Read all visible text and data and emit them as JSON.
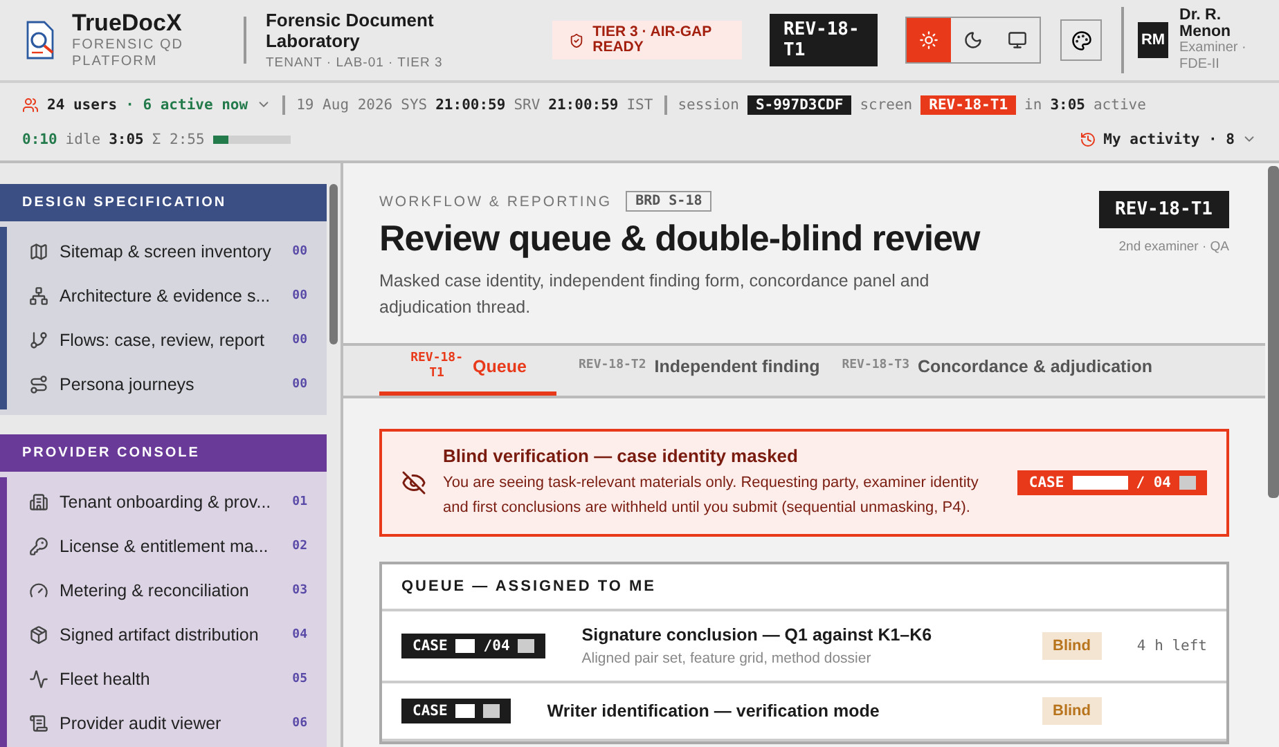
{
  "brand": {
    "name": "TrueDocX",
    "tagline": "FORENSIC QD PLATFORM"
  },
  "lab": {
    "name": "Forensic Document Laboratory",
    "tenant": "TENANT · LAB-01 · TIER 3"
  },
  "tier_badge": "TIER 3 · AIR-GAP READY",
  "screen_code": "REV-18-T1",
  "theme_modes": [
    {
      "kind": "light",
      "selected": true
    },
    {
      "kind": "dark",
      "selected": false
    },
    {
      "kind": "system",
      "selected": false
    }
  ],
  "user": {
    "initials": "RM",
    "name": "Dr. R. Menon",
    "role": "Examiner · FDE-II"
  },
  "status": {
    "rows": [
      {
        "segments": [
          {
            "kind": "users",
            "text": "24 users"
          },
          {
            "kind": "green",
            "text": "· 6 active now"
          },
          {
            "kind": "caret"
          },
          {
            "kind": "sep"
          },
          {
            "kind": "dim",
            "text": "19 Aug 2026"
          },
          {
            "kind": "dim",
            "text": "SYS"
          },
          {
            "kind": "value",
            "text": "21:00:59"
          },
          {
            "kind": "dim",
            "text": "SRV"
          },
          {
            "kind": "value",
            "text": "21:00:59"
          },
          {
            "kind": "dim",
            "text": "IST"
          },
          {
            "kind": "sep"
          },
          {
            "kind": "dim",
            "text": "session"
          },
          {
            "kind": "chip",
            "text": "S-997D3CDF"
          },
          {
            "kind": "dim",
            "text": "screen"
          },
          {
            "kind": "redchip",
            "text": "REV-18-T1"
          },
          {
            "kind": "dim",
            "text": "in"
          },
          {
            "kind": "value",
            "text": "3:05"
          },
          {
            "kind": "dim",
            "text": "active"
          }
        ]
      },
      {
        "segments": [
          {
            "kind": "green",
            "text": "0:10"
          },
          {
            "kind": "dim",
            "text": "idle"
          },
          {
            "kind": "value",
            "text": "3:05"
          },
          {
            "kind": "dim",
            "text": "Σ 2:55"
          },
          {
            "kind": "meter",
            "level": 0.2
          }
        ]
      }
    ],
    "activity": "My activity · 8"
  },
  "sidebar": [
    {
      "title": "DESIGN SPECIFICATION",
      "color": "#3b4f85",
      "items": [
        {
          "label": "Sitemap & screen inventory",
          "count": "00"
        },
        {
          "label": "Architecture & evidence s...",
          "count": "00"
        },
        {
          "label": "Flows: case, review, report",
          "count": "00"
        },
        {
          "label": "Persona journeys",
          "count": "00"
        }
      ]
    },
    {
      "title": "PROVIDER CONSOLE",
      "color": "#6a3a99",
      "items": [
        {
          "label": "Tenant onboarding & prov...",
          "count": "01"
        },
        {
          "label": "License & entitlement ma...",
          "count": "02"
        },
        {
          "label": "Metering & reconciliation",
          "count": "03"
        },
        {
          "label": "Signed artifact distribution",
          "count": "04"
        },
        {
          "label": "Fleet health",
          "count": "05"
        },
        {
          "label": "Provider audit viewer",
          "count": "06"
        }
      ]
    }
  ],
  "page": {
    "eyebrow": "WORKFLOW & REPORTING",
    "brd": "BRD S-18",
    "title": "Review queue & double-blind review",
    "description": "Masked case identity, independent finding form, concordance panel and adjudication thread.",
    "code": "REV-18-T1",
    "code_caption": "2nd examiner · QA"
  },
  "tabs": [
    {
      "code": "REV-18-T1",
      "label": "Queue",
      "selected": true
    },
    {
      "code": "REV-18-T2",
      "label": "Independent finding",
      "selected": false
    },
    {
      "code": "REV-18-T3",
      "label": "Concordance & adjudication",
      "selected": false
    }
  ],
  "alert": {
    "title": "Blind verification — case identity masked",
    "body": "You are seeing task-relevant materials only. Requesting party, examiner identity and first conclusions are withheld until you submit (sequential unmasking, P4).",
    "case_prefix": "CASE",
    "case_suffix": "/ 04"
  },
  "queue": {
    "title": "QUEUE — ASSIGNED TO ME",
    "rows": [
      {
        "case_prefix": "CASE",
        "case_suffix": "/04",
        "title": "Signature conclusion — Q1 against K1–K6",
        "subtitle": "Aligned pair set, feature grid, method dossier",
        "badge": "Blind",
        "due": "4 h left"
      },
      {
        "case_prefix": "CASE",
        "title": "Writer identification — verification mode",
        "badge": "Blind"
      }
    ]
  }
}
